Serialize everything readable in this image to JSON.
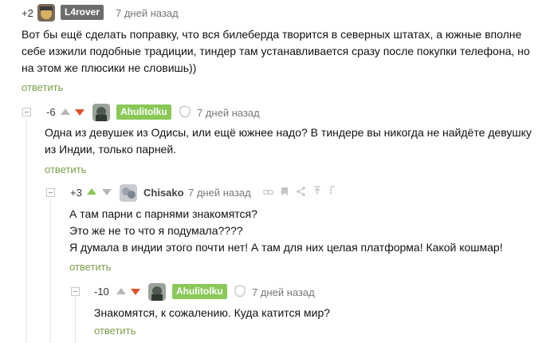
{
  "colors": {
    "accent_green": "#8ac858",
    "downvote_red": "#e0512c",
    "reply_link": "#7b9e4b",
    "author_badge": "#6d6d6d"
  },
  "comments": [
    {
      "rating": "+2",
      "author": "L4rover",
      "time": "7 дней назад",
      "lines": [
        "Вот бы ещё сделать поправку, что вся билеберда творится в северных штатах, а южные вполне",
        "себе изжили подобные традиции, тиндер там устанавливается сразу после покупки телефона, но",
        "на этом же плюсики не словишь))"
      ],
      "reply": "ответить"
    },
    {
      "rating": "-6",
      "author": "Ahulitolku",
      "time": "7 дней назад",
      "lines": [
        "Одна из девушек из Одисы, или ещё южнее надо? В тиндере вы никогда не найдёте девушку",
        "из Индии, только парней."
      ],
      "reply": "ответить"
    },
    {
      "rating": "+3",
      "author": "Chisako",
      "time": "7 дней назад",
      "lines": [
        "А там парни с парнями знакомятся?",
        "Это же не то что я подумала????",
        "Я думала в индии этого почти нет! А там для них целая платформа! Какой кошмар!"
      ],
      "reply": "ответить"
    },
    {
      "rating": "-10",
      "author": "Ahulitolku",
      "time": "7 дней назад",
      "lines": [
        "Знакомятся, к сожалению. Куда катится мир?"
      ],
      "reply": "ответить"
    }
  ],
  "icons": {
    "upvote": "triangle-up",
    "downvote": "triangle-down",
    "collapse": "minus-square",
    "shield": "shield",
    "link": "link",
    "save": "bookmark",
    "share": "share",
    "scroll_up": "arrow-up",
    "reply_tool": "reply"
  }
}
